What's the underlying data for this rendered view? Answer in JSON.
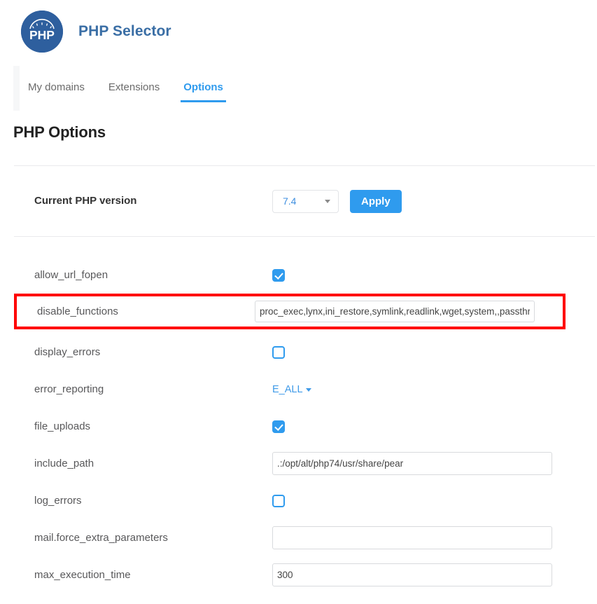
{
  "header": {
    "title": "PHP Selector",
    "logo_text": "PHP",
    "logo_icon": "php-gauge-logo"
  },
  "tabs": [
    {
      "label": "My domains",
      "active": false
    },
    {
      "label": "Extensions",
      "active": false
    },
    {
      "label": "Options",
      "active": true
    }
  ],
  "page": {
    "title": "PHP Options"
  },
  "version_row": {
    "label": "Current PHP version",
    "selected_version": "7.4",
    "apply_label": "Apply",
    "caret_icon": "chevron-down-icon"
  },
  "options": [
    {
      "name": "allow_url_fopen",
      "type": "checkbox",
      "checked": true,
      "highlighted": false
    },
    {
      "name": "disable_functions",
      "type": "text",
      "value": "proc_exec,lynx,ini_restore,symlink,readlink,wget,system,,passthr",
      "placeholder": "",
      "highlighted": true
    },
    {
      "name": "display_errors",
      "type": "checkbox",
      "checked": false,
      "highlighted": false
    },
    {
      "name": "error_reporting",
      "type": "dropdown",
      "value": "E_ALL",
      "caret_icon": "caret-down-icon",
      "highlighted": false
    },
    {
      "name": "file_uploads",
      "type": "checkbox",
      "checked": true,
      "highlighted": false
    },
    {
      "name": "include_path",
      "type": "text",
      "value": ".:/opt/alt/php74/usr/share/pear",
      "placeholder": "",
      "highlighted": false
    },
    {
      "name": "log_errors",
      "type": "checkbox",
      "checked": false,
      "highlighted": false
    },
    {
      "name": "mail.force_extra_parameters",
      "type": "text",
      "value": "",
      "placeholder": "",
      "highlighted": false
    },
    {
      "name": "max_execution_time",
      "type": "text",
      "value": "300",
      "placeholder": "",
      "highlighted": false
    }
  ],
  "colors": {
    "accent_blue": "#2f9bee",
    "logo_blue": "#2e5f9e",
    "title_blue": "#3a6ea5",
    "highlight_red": "#ff0000",
    "divider_gray": "#e9eaec"
  }
}
